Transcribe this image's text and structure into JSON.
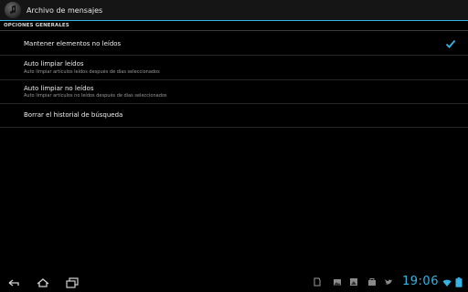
{
  "action_bar": {
    "title": "Archivo de mensajes",
    "icon": "music-note-icon"
  },
  "category": {
    "label": "OPCIONES GENERALES"
  },
  "preferences": [
    {
      "title": "Mantener elementos no leídos",
      "summary": "",
      "checked": true
    },
    {
      "title": "Auto limpiar leídos",
      "summary": "Auto limpiar artículos leídos después de días seleccionados"
    },
    {
      "title": "Auto limpiar no leídos",
      "summary": "Auto limpiar artículos no leídos después de días seleccionados"
    },
    {
      "title": "Borrar el historial de búsqueda",
      "summary": ""
    }
  ],
  "system_bar": {
    "clock": "19:06",
    "accent_color": "#33b5e5",
    "nav_buttons": [
      "back-icon",
      "home-icon",
      "recent-apps-icon"
    ],
    "status_icons": [
      "notification-icon",
      "gallery-icon",
      "media-icon",
      "shop-icon",
      "twitter-icon",
      "wifi-icon",
      "battery-icon"
    ]
  }
}
